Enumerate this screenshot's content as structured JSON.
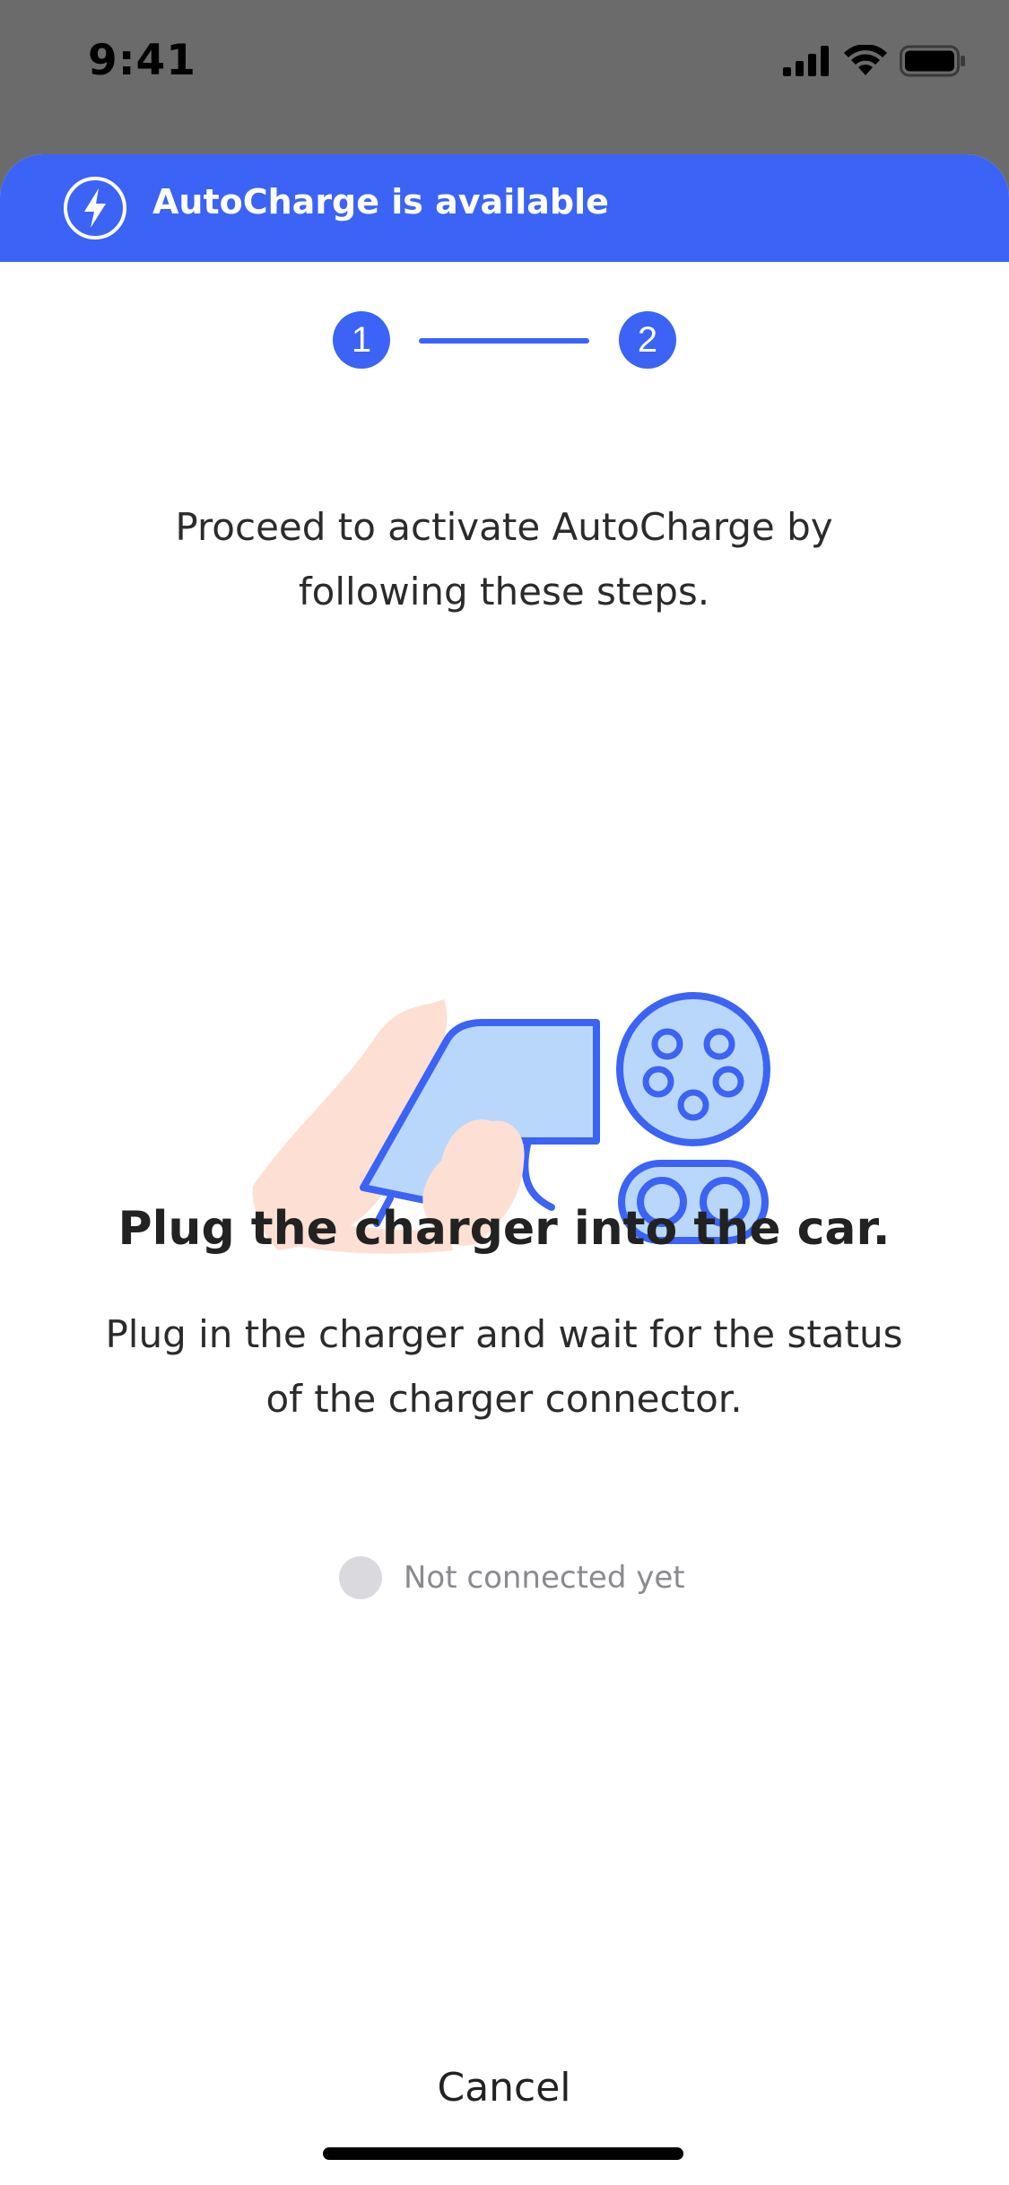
{
  "status_bar": {
    "time": "9:41",
    "icons": [
      "cellular-signal-icon",
      "wifi-icon",
      "battery-icon"
    ]
  },
  "banner": {
    "icon": "lightning-bolt-icon",
    "title": "AutoCharge is available",
    "color": "#3b63f5"
  },
  "stepper": {
    "steps": [
      "1",
      "2"
    ],
    "current_step": 1
  },
  "intro_text": "Proceed to activate AutoCharge by following these steps.",
  "illustration": {
    "icon": "charger-plug-illustration"
  },
  "headline": "Plug the charger into the car.",
  "description": "Plug in the charger and wait for the status of the charger connector.",
  "connection_status": {
    "label": "Not connected yet"
  },
  "cancel_label": "Cancel",
  "colors": {
    "accent": "#3b63f5",
    "light_accent": "#b9d7fb",
    "skin": "#fde0d3",
    "status_inactive": "#d9d9de"
  }
}
